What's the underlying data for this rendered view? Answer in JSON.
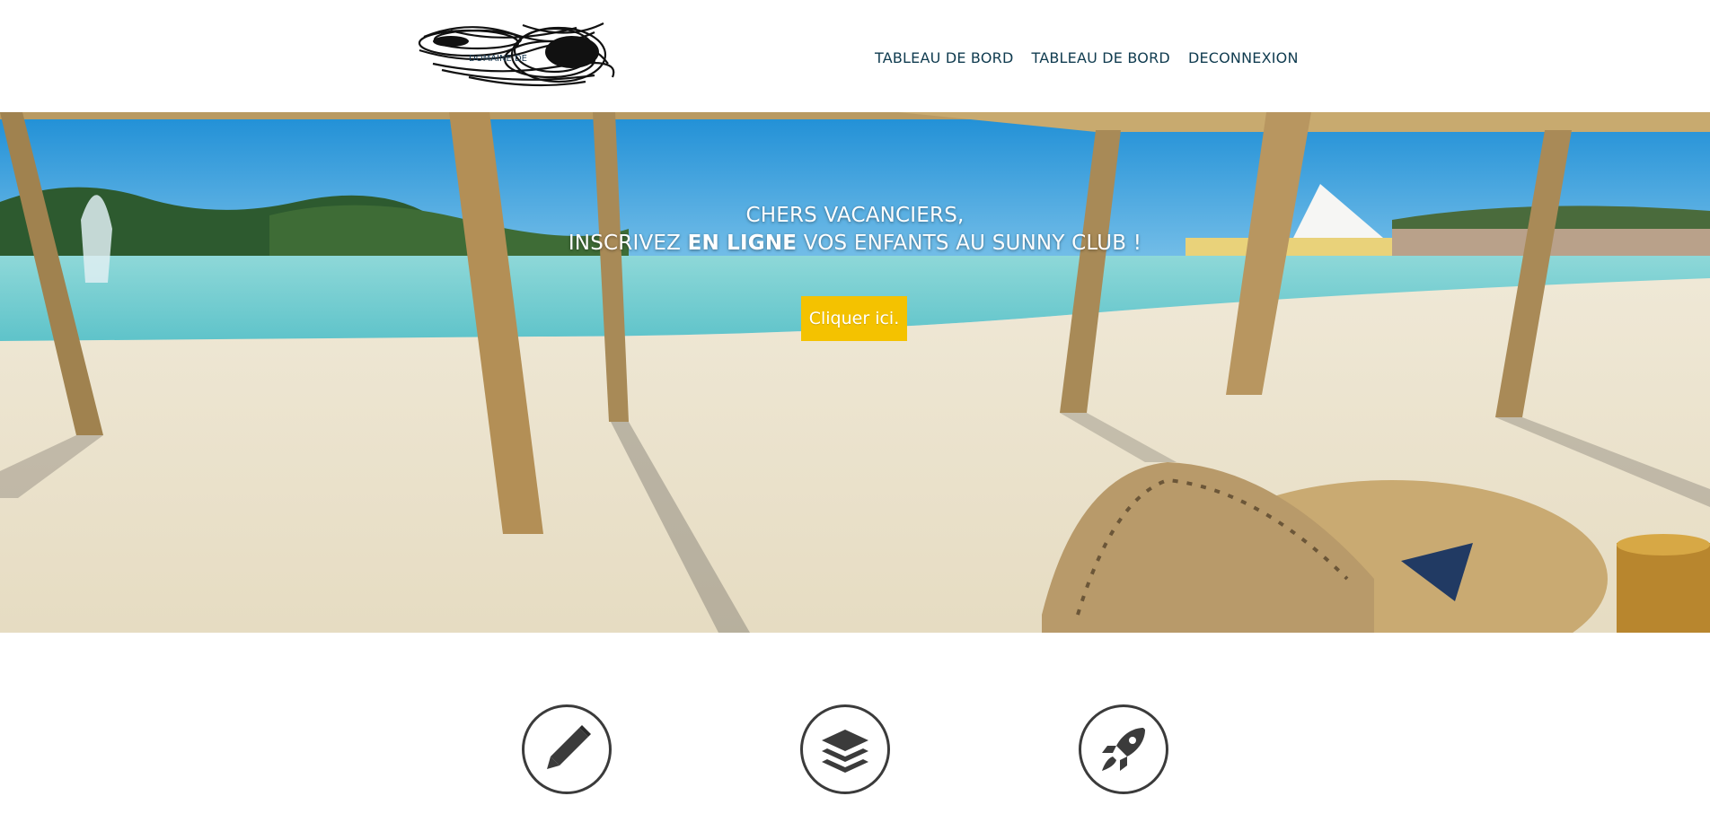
{
  "header": {
    "logo_text": "DOMAINE DE",
    "nav": [
      {
        "label": "TABLEAU DE BORD"
      },
      {
        "label": "TABLEAU DE BORD"
      },
      {
        "label": "DECONNEXION"
      }
    ]
  },
  "hero": {
    "line1": "CHERS VACANCIERS,",
    "line2_prefix": "INSCRIVEZ ",
    "line2_bold": "EN LIGNE",
    "line2_suffix": " VOS ENFANTS AU SUNNY CLUB !",
    "button_label": "Cliquer ici."
  },
  "features": [
    {
      "icon": "pen-icon"
    },
    {
      "icon": "layers-icon"
    },
    {
      "icon": "rocket-icon"
    }
  ],
  "colors": {
    "nav_text": "#0f3b4f",
    "cta": "#f4c200",
    "icon_stroke": "#3b3b3b"
  }
}
